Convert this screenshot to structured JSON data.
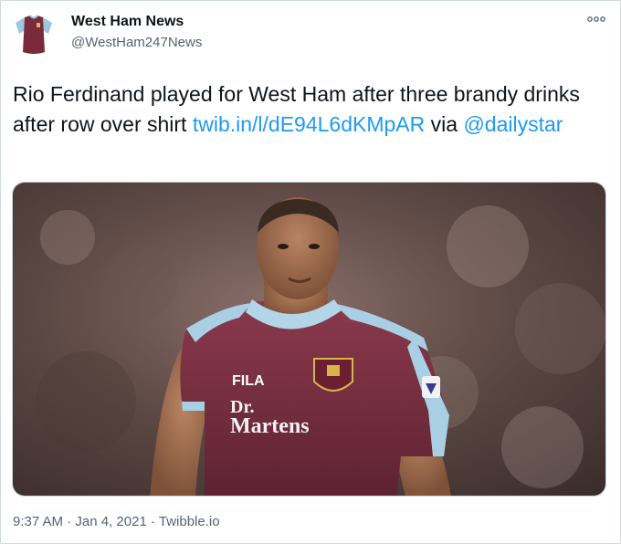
{
  "account": {
    "display_name": "West Ham News",
    "handle": "@WestHam247News",
    "avatar_icon": "claret-jersey-icon"
  },
  "menu": {
    "icon": "more-options-icon"
  },
  "tweet": {
    "text_plain": "Rio Ferdinand played for West Ham after three brandy drinks after row over shirt ",
    "link": "twib.in/l/dE94L6dKMpAR",
    "text_via": " via ",
    "mention": "@dailystar"
  },
  "media": {
    "shirt_sponsor_line1": "Dr.",
    "shirt_sponsor_line2": "Martens",
    "kit_brand": "FILA"
  },
  "meta": {
    "time": "9:37 AM",
    "separator1": " · ",
    "date": "Jan 4, 2021",
    "separator2": " · ",
    "source": "Twibble.io"
  },
  "colors": {
    "link": "#1d9bf0",
    "secondary_text": "#536471",
    "claret": "#7a2a3a",
    "sky_blue": "#9ec6e0"
  }
}
